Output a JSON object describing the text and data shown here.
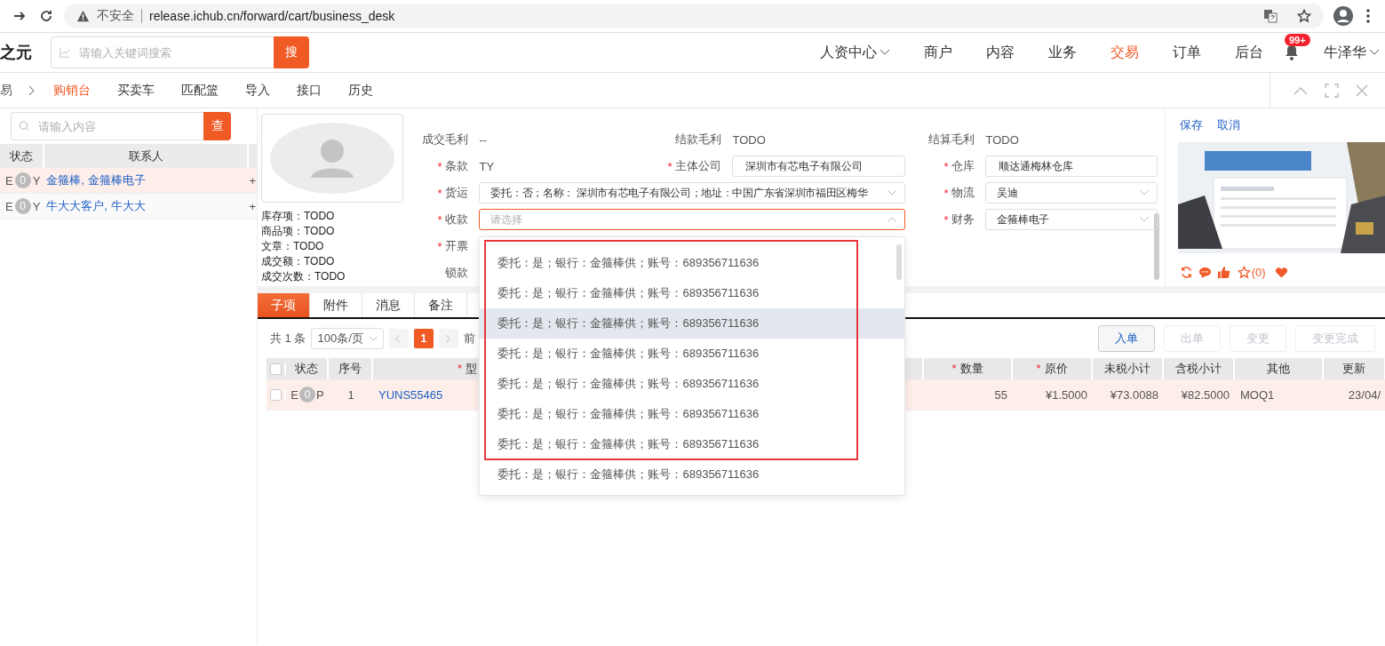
{
  "browser": {
    "security_label": "不安全",
    "url": "release.ichub.cn/forward/cart/business_desk"
  },
  "header": {
    "logo": "之元",
    "search": {
      "placeholder": "请输入关键词搜索",
      "button": "搜"
    },
    "nav": [
      {
        "label": "人资中心",
        "dropdown": true,
        "selected": false
      },
      {
        "label": "商户",
        "dropdown": false,
        "selected": false
      },
      {
        "label": "内容",
        "dropdown": false,
        "selected": false
      },
      {
        "label": "业务",
        "dropdown": false,
        "selected": false
      },
      {
        "label": "交易",
        "dropdown": false,
        "selected": true
      },
      {
        "label": "订单",
        "dropdown": false,
        "selected": false
      },
      {
        "label": "后台",
        "dropdown": false,
        "selected": false
      }
    ],
    "notifications": {
      "badge": "99+"
    },
    "user": {
      "name": "牛泽华"
    }
  },
  "breadcrumb": {
    "parent": "易",
    "tabs": [
      {
        "label": "购销台",
        "selected": true
      },
      {
        "label": "买卖车",
        "selected": false
      },
      {
        "label": "匹配篮",
        "selected": false
      },
      {
        "label": "导入",
        "selected": false
      },
      {
        "label": "接口",
        "selected": false
      },
      {
        "label": "历史",
        "selected": false
      }
    ]
  },
  "left_panel": {
    "search": {
      "placeholder": "请输入内容",
      "button": "查"
    },
    "columns": [
      "状态",
      "联系人"
    ],
    "rows": [
      {
        "status_prefix": "E",
        "count": "0",
        "status_suffix": "Y",
        "contact": "金箍棒, 金箍棒电子",
        "action": "+",
        "selected": true
      },
      {
        "status_prefix": "E",
        "count": "0",
        "status_suffix": "Y",
        "contact": "牛大大客户, 牛大大",
        "action": "+",
        "selected": false
      }
    ]
  },
  "profile": {
    "stats": [
      "库存项：TODO",
      "商品项：TODO",
      "文章：TODO",
      "成交额：TODO",
      "成交次数：TODO"
    ]
  },
  "form": {
    "rows": [
      {
        "fields": [
          {
            "label": "成交毛利",
            "kind": "text",
            "value": "--"
          },
          {
            "label": "结款毛利",
            "kind": "text",
            "value": "TODO"
          },
          {
            "label": "结算毛利",
            "kind": "text",
            "value": "TODO"
          }
        ]
      },
      {
        "fields": [
          {
            "mark": "*",
            "label": "条款",
            "kind": "text",
            "value": "TY"
          },
          {
            "mark": "*",
            "label": "主体公司",
            "kind": "input",
            "value": "深圳市有芯电子有限公司"
          },
          {
            "mark": "*",
            "label": "仓库",
            "kind": "input",
            "value": "顺达通梅林仓库"
          }
        ]
      },
      {
        "fields": [
          {
            "mark": "*",
            "label": "货运",
            "kind": "select",
            "value": "委托：否；名称： 深圳市有芯电子有限公司；地址：中国广东省深圳市福田区梅华",
            "open": false
          },
          {
            "mark": "*",
            "label": "物流",
            "kind": "select",
            "value": "吴迪",
            "open": false
          }
        ]
      },
      {
        "fields": [
          {
            "mark": "*",
            "label": "收款",
            "kind": "select",
            "placeholder": "请选择",
            "open": true,
            "options": [
              {
                "text": "委托：是；银行：金箍棒供；账号：689356711636",
                "highlighted": false
              },
              {
                "text": "委托：是；银行：金箍棒供；账号：689356711636",
                "highlighted": false
              },
              {
                "text": "委托：是；银行：金箍棒供；账号：689356711636",
                "highlighted": true
              },
              {
                "text": "委托：是；银行：金箍棒供；账号：689356711636",
                "highlighted": false
              },
              {
                "text": "委托：是；银行：金箍棒供；账号：689356711636",
                "highlighted": false
              },
              {
                "text": "委托：是；银行：金箍棒供；账号：689356711636",
                "highlighted": false
              },
              {
                "text": "委托：是；银行：金箍棒供；账号：689356711636",
                "highlighted": false
              },
              {
                "text": "委托：是；银行：金箍棒供；账号：689356711636",
                "highlighted": false
              }
            ]
          },
          {
            "mark": "*",
            "label": "财务",
            "kind": "select",
            "value": "金箍棒电子",
            "open": false
          }
        ]
      },
      {
        "fields": [
          {
            "mark": "*",
            "label": "开票",
            "kind": "blank"
          }
        ]
      },
      {
        "fields": [
          {
            "label": "锁款",
            "kind": "blank"
          }
        ]
      }
    ]
  },
  "side_panel": {
    "actions": [
      "保存",
      "取消"
    ],
    "favorites": "(0)"
  },
  "detail_tabs": [
    {
      "label": "子项",
      "selected": true
    },
    {
      "label": "附件",
      "selected": false
    },
    {
      "label": "消息",
      "selected": false
    },
    {
      "label": "备注",
      "selected": false
    }
  ],
  "pagination": {
    "total": "共 1 条",
    "page_size": "100条/页",
    "pages": [
      {
        "label": "1",
        "selected": true
      }
    ],
    "goto": "前"
  },
  "toolbar": [
    {
      "label": "入单",
      "disabled": false
    },
    {
      "label": "出单",
      "disabled": true
    },
    {
      "label": "变更",
      "disabled": true
    },
    {
      "label": "变更完成",
      "disabled": true
    }
  ],
  "items_table": {
    "all_checked": false,
    "columns": [
      {
        "label": "状态"
      },
      {
        "label": "序号"
      },
      {
        "mark": "*",
        "label": "型"
      },
      {
        "mark": "*",
        "label": "数量"
      },
      {
        "mark": "*",
        "label": "原价"
      },
      {
        "label": "未税小计"
      },
      {
        "label": "含税小计"
      },
      {
        "label": "其他"
      },
      {
        "label": "更新"
      }
    ],
    "rows": [
      {
        "checked": false,
        "status_prefix": "E",
        "count": "0",
        "status_suffix": "P",
        "index": "1",
        "model": "YUNS55465",
        "quantity": "55",
        "price": "¥1.5000",
        "net_subtotal": "¥73.0088",
        "gross_subtotal": "¥82.5000",
        "other": "MOQ1",
        "updated": "23/04/"
      }
    ]
  }
}
